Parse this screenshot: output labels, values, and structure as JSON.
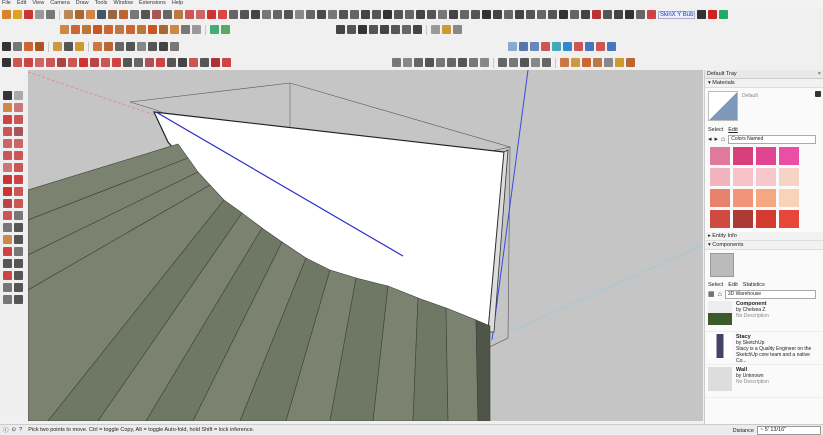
{
  "menu": [
    "File",
    "Edit",
    "View",
    "Camera",
    "Draw",
    "Tools",
    "Window",
    "Extensions",
    "Help"
  ],
  "toolbar_brand": "SkinX Y Bub",
  "panel": {
    "tray_title": "Default Tray",
    "materials_title": "Materials",
    "material_name": "Default",
    "tabs_select": "Select",
    "tabs_edit": "Edit",
    "colors_dropdown": "Colors Named",
    "entity_info": "Entity Info",
    "components_title": "Components",
    "comp_tab_select": "Select",
    "comp_tab_edit": "Edit",
    "comp_tab_stats": "Statistics",
    "warehouse_placeholder": "3D Warehouse",
    "components": [
      {
        "name": "Component",
        "by": "by Chelsea Z",
        "desc": "No Description"
      },
      {
        "name": "Stacy",
        "by": "by SketchUp",
        "desc": "Stacy is a Quality Engineer on the SketchUp core team and a native Co..."
      },
      {
        "name": "Wall",
        "by": "by Unknown",
        "desc": "No Description"
      }
    ]
  },
  "status": {
    "hint": "Pick two points to move.  Ctrl = toggle Copy, Alt = toggle Auto-fold, hold Shift = lock inference.",
    "distance_label": "Distance",
    "distance_value": "~ 5' 13/16\""
  },
  "colors": {
    "viewport_bg": "#c5c5c5",
    "stair": "#7b8370",
    "stair_dark": "#4f5649",
    "wall": "#ffffff"
  }
}
